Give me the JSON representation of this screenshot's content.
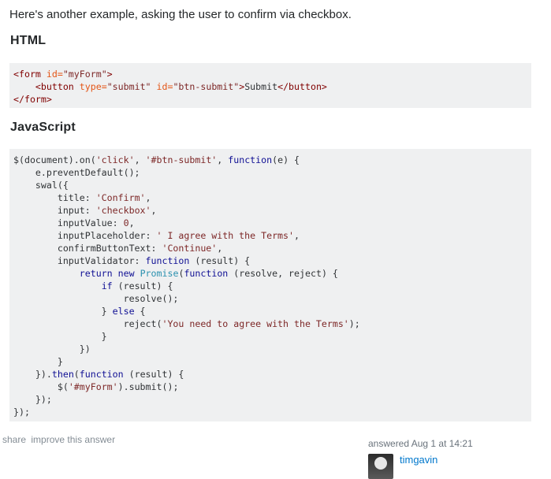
{
  "answer": {
    "intro": "Here's another example, asking the user to confirm via checkbox.",
    "html_heading": "HTML",
    "js_heading": "JavaScript",
    "html_code": {
      "line1_tag_open": "<form",
      "line1_attr": " id=",
      "line1_val": "\"myForm\"",
      "line1_close": ">",
      "line2_indent": "    ",
      "line2_tag_open": "<button",
      "line2_attr1": " type=",
      "line2_val1": "\"submit\"",
      "line2_attr2": " id=",
      "line2_val2": "\"btn-submit\"",
      "line2_close": ">",
      "line2_text": "Submit",
      "line2_end": "</button>",
      "line3": "</form>"
    }
  },
  "post_menu": {
    "share": "share",
    "improve": "improve this answer"
  },
  "user": {
    "action_time": "answered Aug 1 at 14:21",
    "name": "timgavin"
  }
}
